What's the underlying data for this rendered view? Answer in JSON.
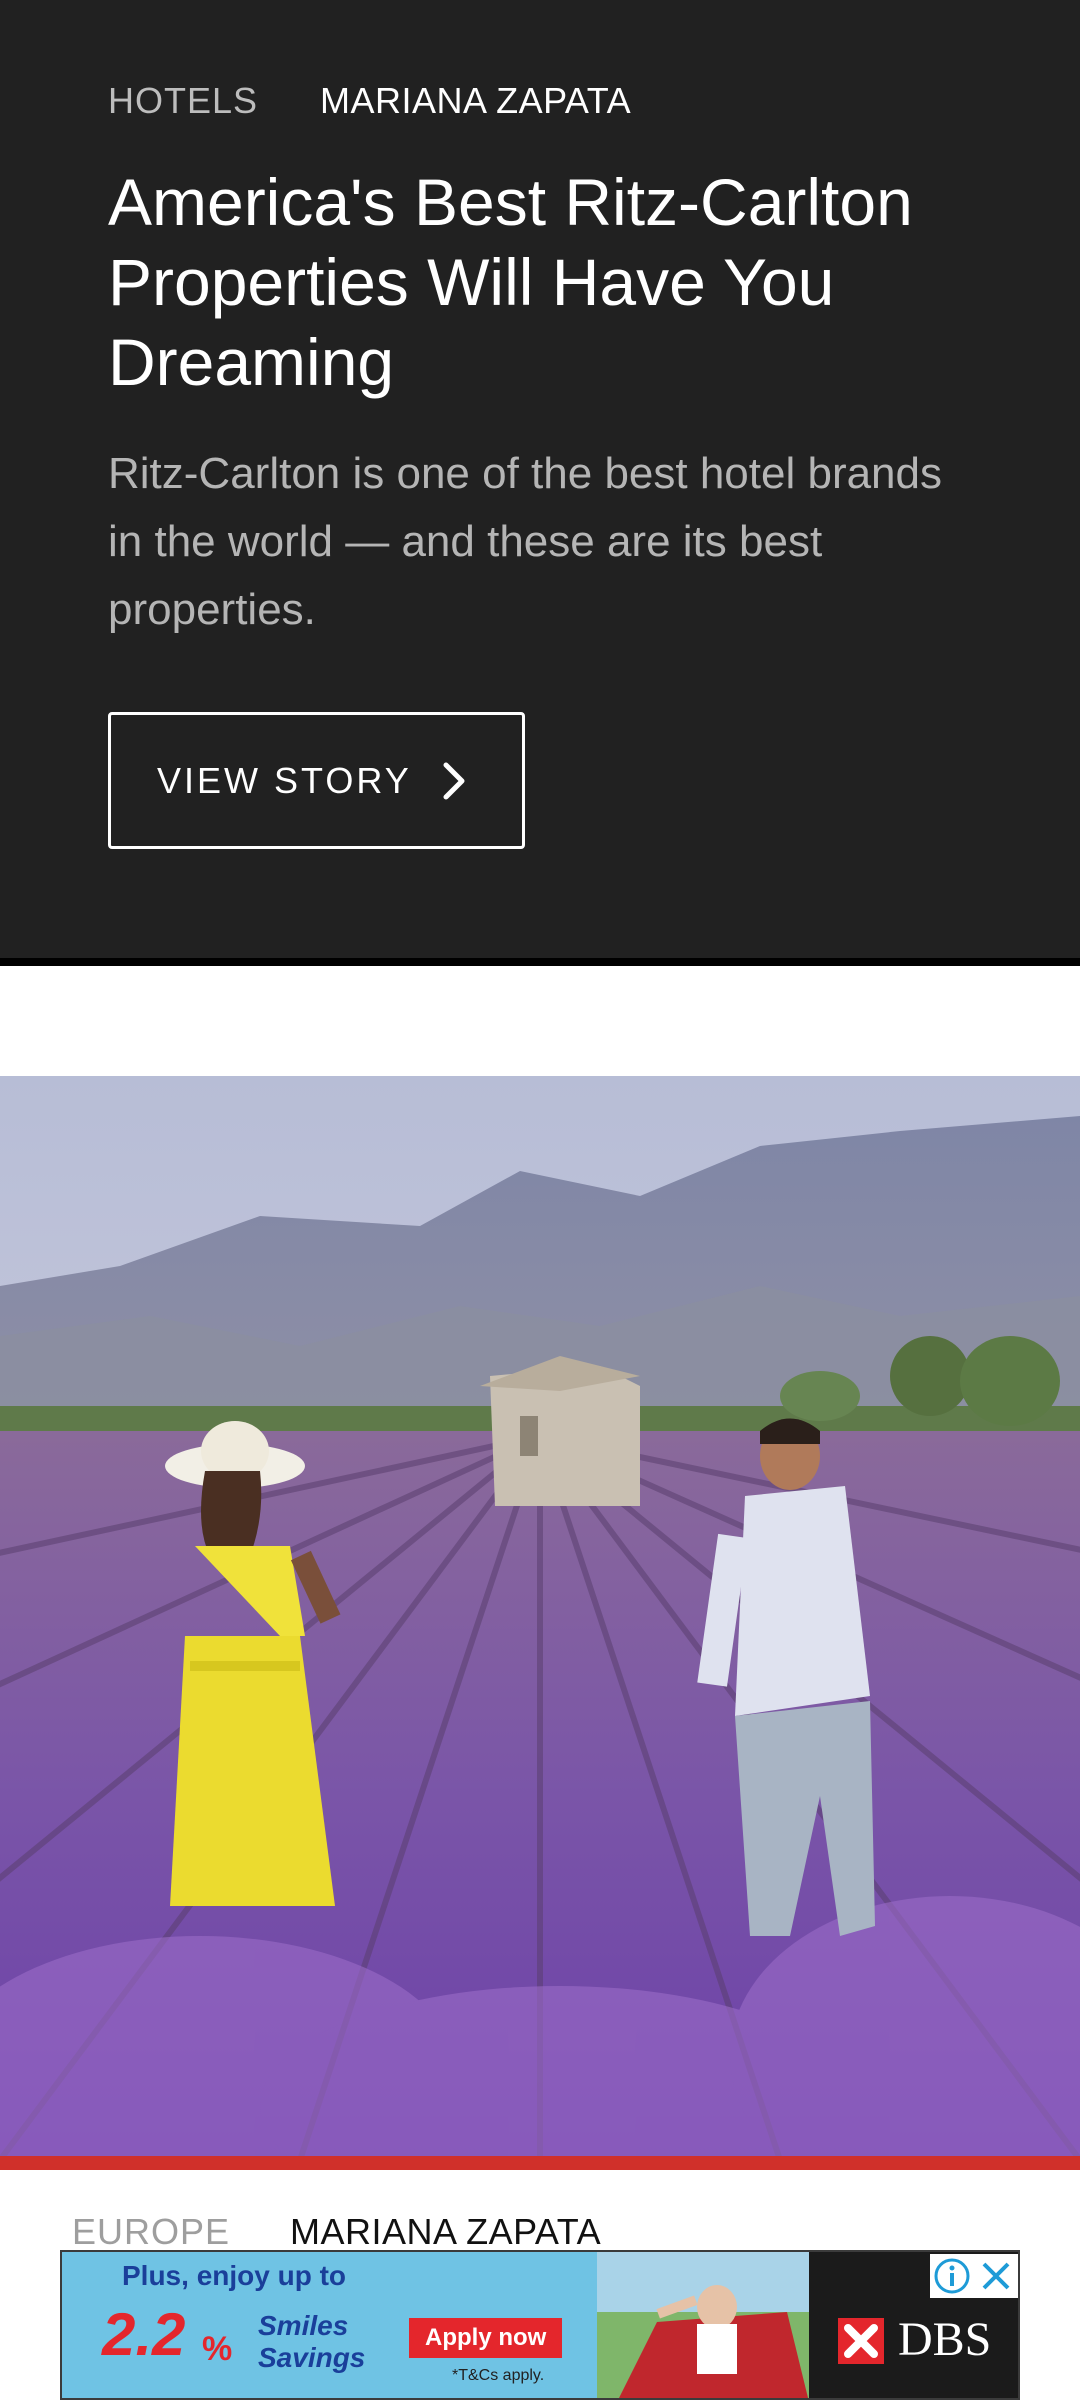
{
  "story_card": {
    "category": "HOTELS",
    "author": "MARIANA ZAPATA",
    "headline": "America's Best Ritz-Carlton Properties Will Have You Dreaming",
    "dek": "Ritz-Carlton is one of the best hotel brands in the world — and these are its best properties.",
    "button_label": "VIEW STORY"
  },
  "hero_image": {
    "description": "Couple walking through lavender field with stone hut and mountains"
  },
  "next_story": {
    "category": "EUROPE",
    "author": "MARIANA ZAPATA"
  },
  "ad": {
    "line1": "Plus, enjoy up to",
    "percent": "2.2",
    "percent_symbol": "%",
    "smiles": "Smiles Savings",
    "apply": "Apply now",
    "terms": "*T&Cs apply.",
    "brand": "DBS"
  },
  "colors": {
    "card_bg": "#212121",
    "accent_red": "#d0302a",
    "ad_bg": "#6fc3e4"
  }
}
